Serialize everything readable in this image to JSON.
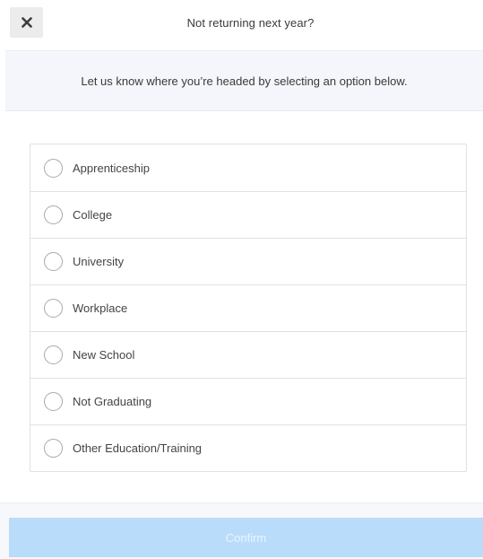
{
  "header": {
    "title": "Not returning next year?"
  },
  "subheader": {
    "text": "Let us know where you’re headed by selecting an option below."
  },
  "options": [
    {
      "label": "Apprenticeship",
      "selected": false
    },
    {
      "label": "College",
      "selected": false
    },
    {
      "label": "University",
      "selected": false
    },
    {
      "label": "Workplace",
      "selected": false
    },
    {
      "label": "New School",
      "selected": false
    },
    {
      "label": "Not Graduating",
      "selected": false
    },
    {
      "label": "Other Education/Training",
      "selected": false
    }
  ],
  "footer": {
    "confirm_label": "Confirm"
  },
  "colors": {
    "confirm_disabled_bg": "#b9dcfb",
    "subheader_bg": "#f5f6fb"
  }
}
